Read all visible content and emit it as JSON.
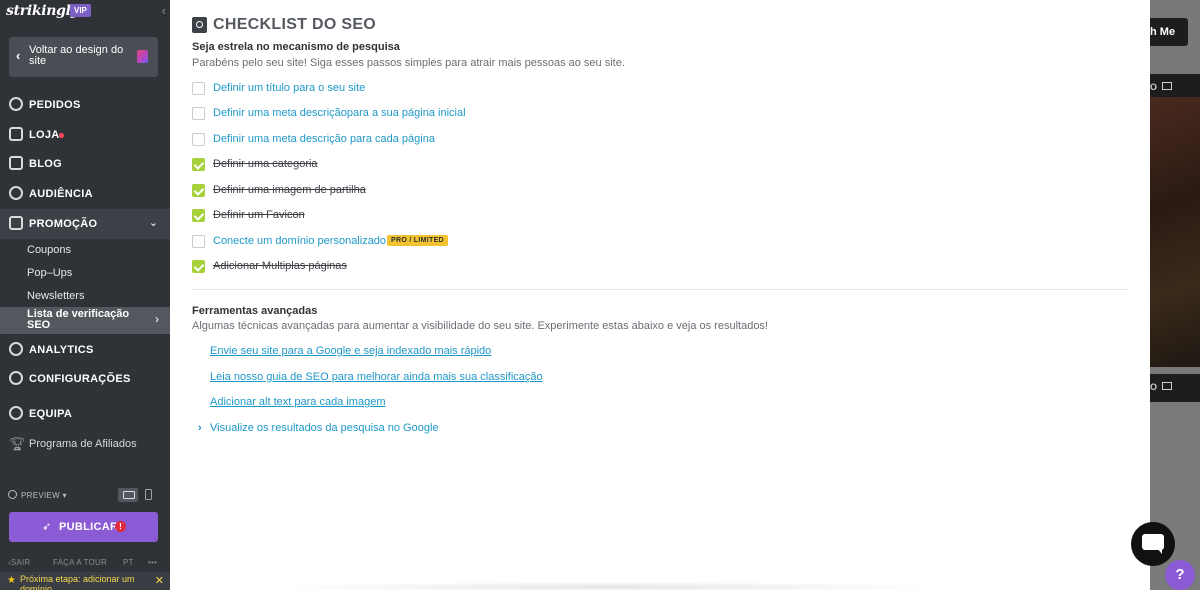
{
  "app": {
    "logo": "strikingly",
    "vip_badge": "VIP"
  },
  "sidebar": {
    "back_button": "Voltar ao design do site",
    "items": [
      {
        "label": "PEDIDOS",
        "icon": "dollar-circle-icon"
      },
      {
        "label": "LOJA",
        "icon": "store-icon",
        "has_dot": true
      },
      {
        "label": "BLOG",
        "icon": "pen-icon"
      },
      {
        "label": "AUDIÊNCIA",
        "icon": "people-icon"
      },
      {
        "label": "PROMOÇÃO",
        "icon": "megaphone-icon",
        "expanded": true
      },
      {
        "label": "ANALYTICS",
        "icon": "pie-chart-icon"
      },
      {
        "label": "CONFIGURAÇÕES",
        "icon": "gear-icon"
      },
      {
        "label": "EQUIPA",
        "icon": "team-icon"
      }
    ],
    "sub_items": [
      "Coupons",
      "Pop–Ups",
      "Newsletters"
    ],
    "sub_active": "Lista de verificação SEO",
    "affiliate": "Programa de Afiliados",
    "preview_label": "PREVIEW",
    "publish_label": "PUBLICAR",
    "footer_links": [
      "SAIR",
      "FAÇA A TOUR",
      "PT",
      "•••"
    ],
    "next_step": "Próxima etapa: adicionar um domínio"
  },
  "main": {
    "title": "CHECKLIST DO SEO",
    "section1": {
      "title": "Seja estrela no mecanismo de pesquisa",
      "subtitle": "Parabéns pelo seu site! Siga esses passos simples para atrair mais pessoas ao seu site."
    },
    "checklist": [
      {
        "label": "Definir um título para o seu site",
        "done": false
      },
      {
        "label": "Definir uma meta descriçãopara a sua página inicial",
        "done": false
      },
      {
        "label": "Definir uma meta descrição para cada página",
        "done": false
      },
      {
        "label": "Definir uma categoria",
        "done": true
      },
      {
        "label": "Definir uma imagem de partilha",
        "done": true
      },
      {
        "label": "Definir um Favicon",
        "done": true
      },
      {
        "label": "Conecte um domínio personalizado",
        "done": false,
        "badge": "PRO / LIMITED"
      },
      {
        "label": "Adicionar Multiplas páginas",
        "done": true
      }
    ],
    "section2": {
      "title": "Ferramentas avançadas",
      "subtitle": "Algumas técnicas avançadas para aumentar a visibilidade do seu site. Experimente estas abaixo e veja os resultados!"
    },
    "tools": [
      "Envie seu site para a Google e seja indexado mais rápido",
      "Leia nosso guia de SEO para melhorar ainda mais sua classificação",
      "Adicionar alt text para cada imagem"
    ],
    "expand_link": "Visualize os resultados da pesquisa no Google"
  },
  "backdrop": {
    "button_text": "h Me",
    "strip_text": "O"
  },
  "help": {
    "label": "?"
  }
}
